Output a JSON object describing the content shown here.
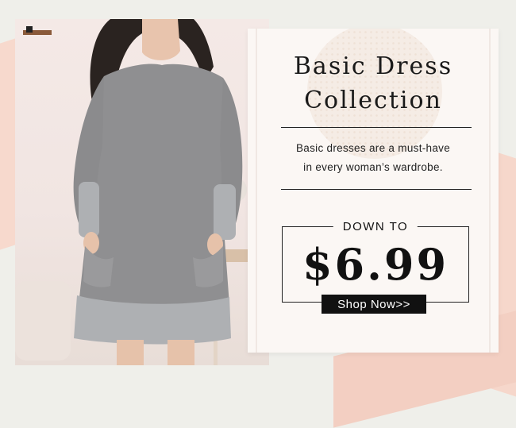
{
  "banner": {
    "title_line1": "Basic Dress",
    "title_line2": "Collection",
    "description_line1": "Basic dresses are a must-have",
    "description_line2": "in every woman’s wardrobe.",
    "promo_label": "DOWN TO",
    "price": "$6.99",
    "cta_label": "Shop Now>>"
  },
  "colors": {
    "background": "#efefea",
    "peach": "#f7d9cd",
    "card": "#fbf7f4",
    "dress": "#8f8f91",
    "text": "#111111"
  }
}
